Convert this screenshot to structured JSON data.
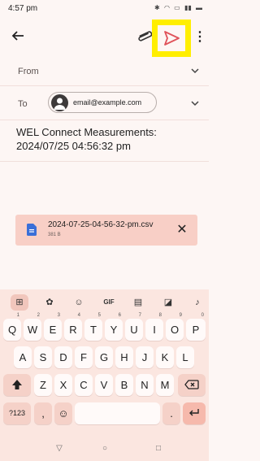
{
  "status": {
    "time": "4:57 pm",
    "icons": [
      "bluetooth-icon",
      "wifi-icon",
      "volte-icon",
      "signal-icon",
      "battery-icon"
    ]
  },
  "toolbar": {
    "back_icon": "arrow-left-icon",
    "attach_icon": "paperclip-icon",
    "send_icon": "send-icon",
    "more_icon": "more-vert-icon",
    "highlight_color": "#ffee00"
  },
  "compose": {
    "from_label": "From",
    "to_label": "To",
    "recipient": "email@example.com",
    "subject_line1": "WEL Connect Measurements:",
    "subject_line2": "2024/07/25 04:56:32 pm"
  },
  "attachment": {
    "name": "2024-07-25-04-56-32-pm.csv",
    "size": "381 B"
  },
  "keyboard": {
    "tools": [
      "apps-icon",
      "palette-icon",
      "sticker-icon",
      "GIF",
      "clipboard-icon",
      "screenshot-icon",
      "mic-icon"
    ],
    "row1": [
      {
        "k": "Q",
        "s": "1"
      },
      {
        "k": "W",
        "s": "2"
      },
      {
        "k": "E",
        "s": "3"
      },
      {
        "k": "R",
        "s": "4"
      },
      {
        "k": "T",
        "s": "5"
      },
      {
        "k": "Y",
        "s": "6"
      },
      {
        "k": "U",
        "s": "7"
      },
      {
        "k": "I",
        "s": "8"
      },
      {
        "k": "O",
        "s": "9"
      },
      {
        "k": "P",
        "s": "0"
      }
    ],
    "row2": [
      "A",
      "S",
      "D",
      "F",
      "G",
      "H",
      "J",
      "K",
      "L"
    ],
    "row3": [
      "Z",
      "X",
      "C",
      "V",
      "B",
      "N",
      "M"
    ],
    "symbols_label": "?123",
    "comma": ",",
    "period": ".",
    "colors": {
      "bg": "#fbe6e0",
      "key": "#fffaf9",
      "accent": "#f6b9ac"
    }
  },
  "nav": {
    "back": "triangle-back-icon",
    "home": "circle-home-icon",
    "recents": "square-recents-icon"
  }
}
